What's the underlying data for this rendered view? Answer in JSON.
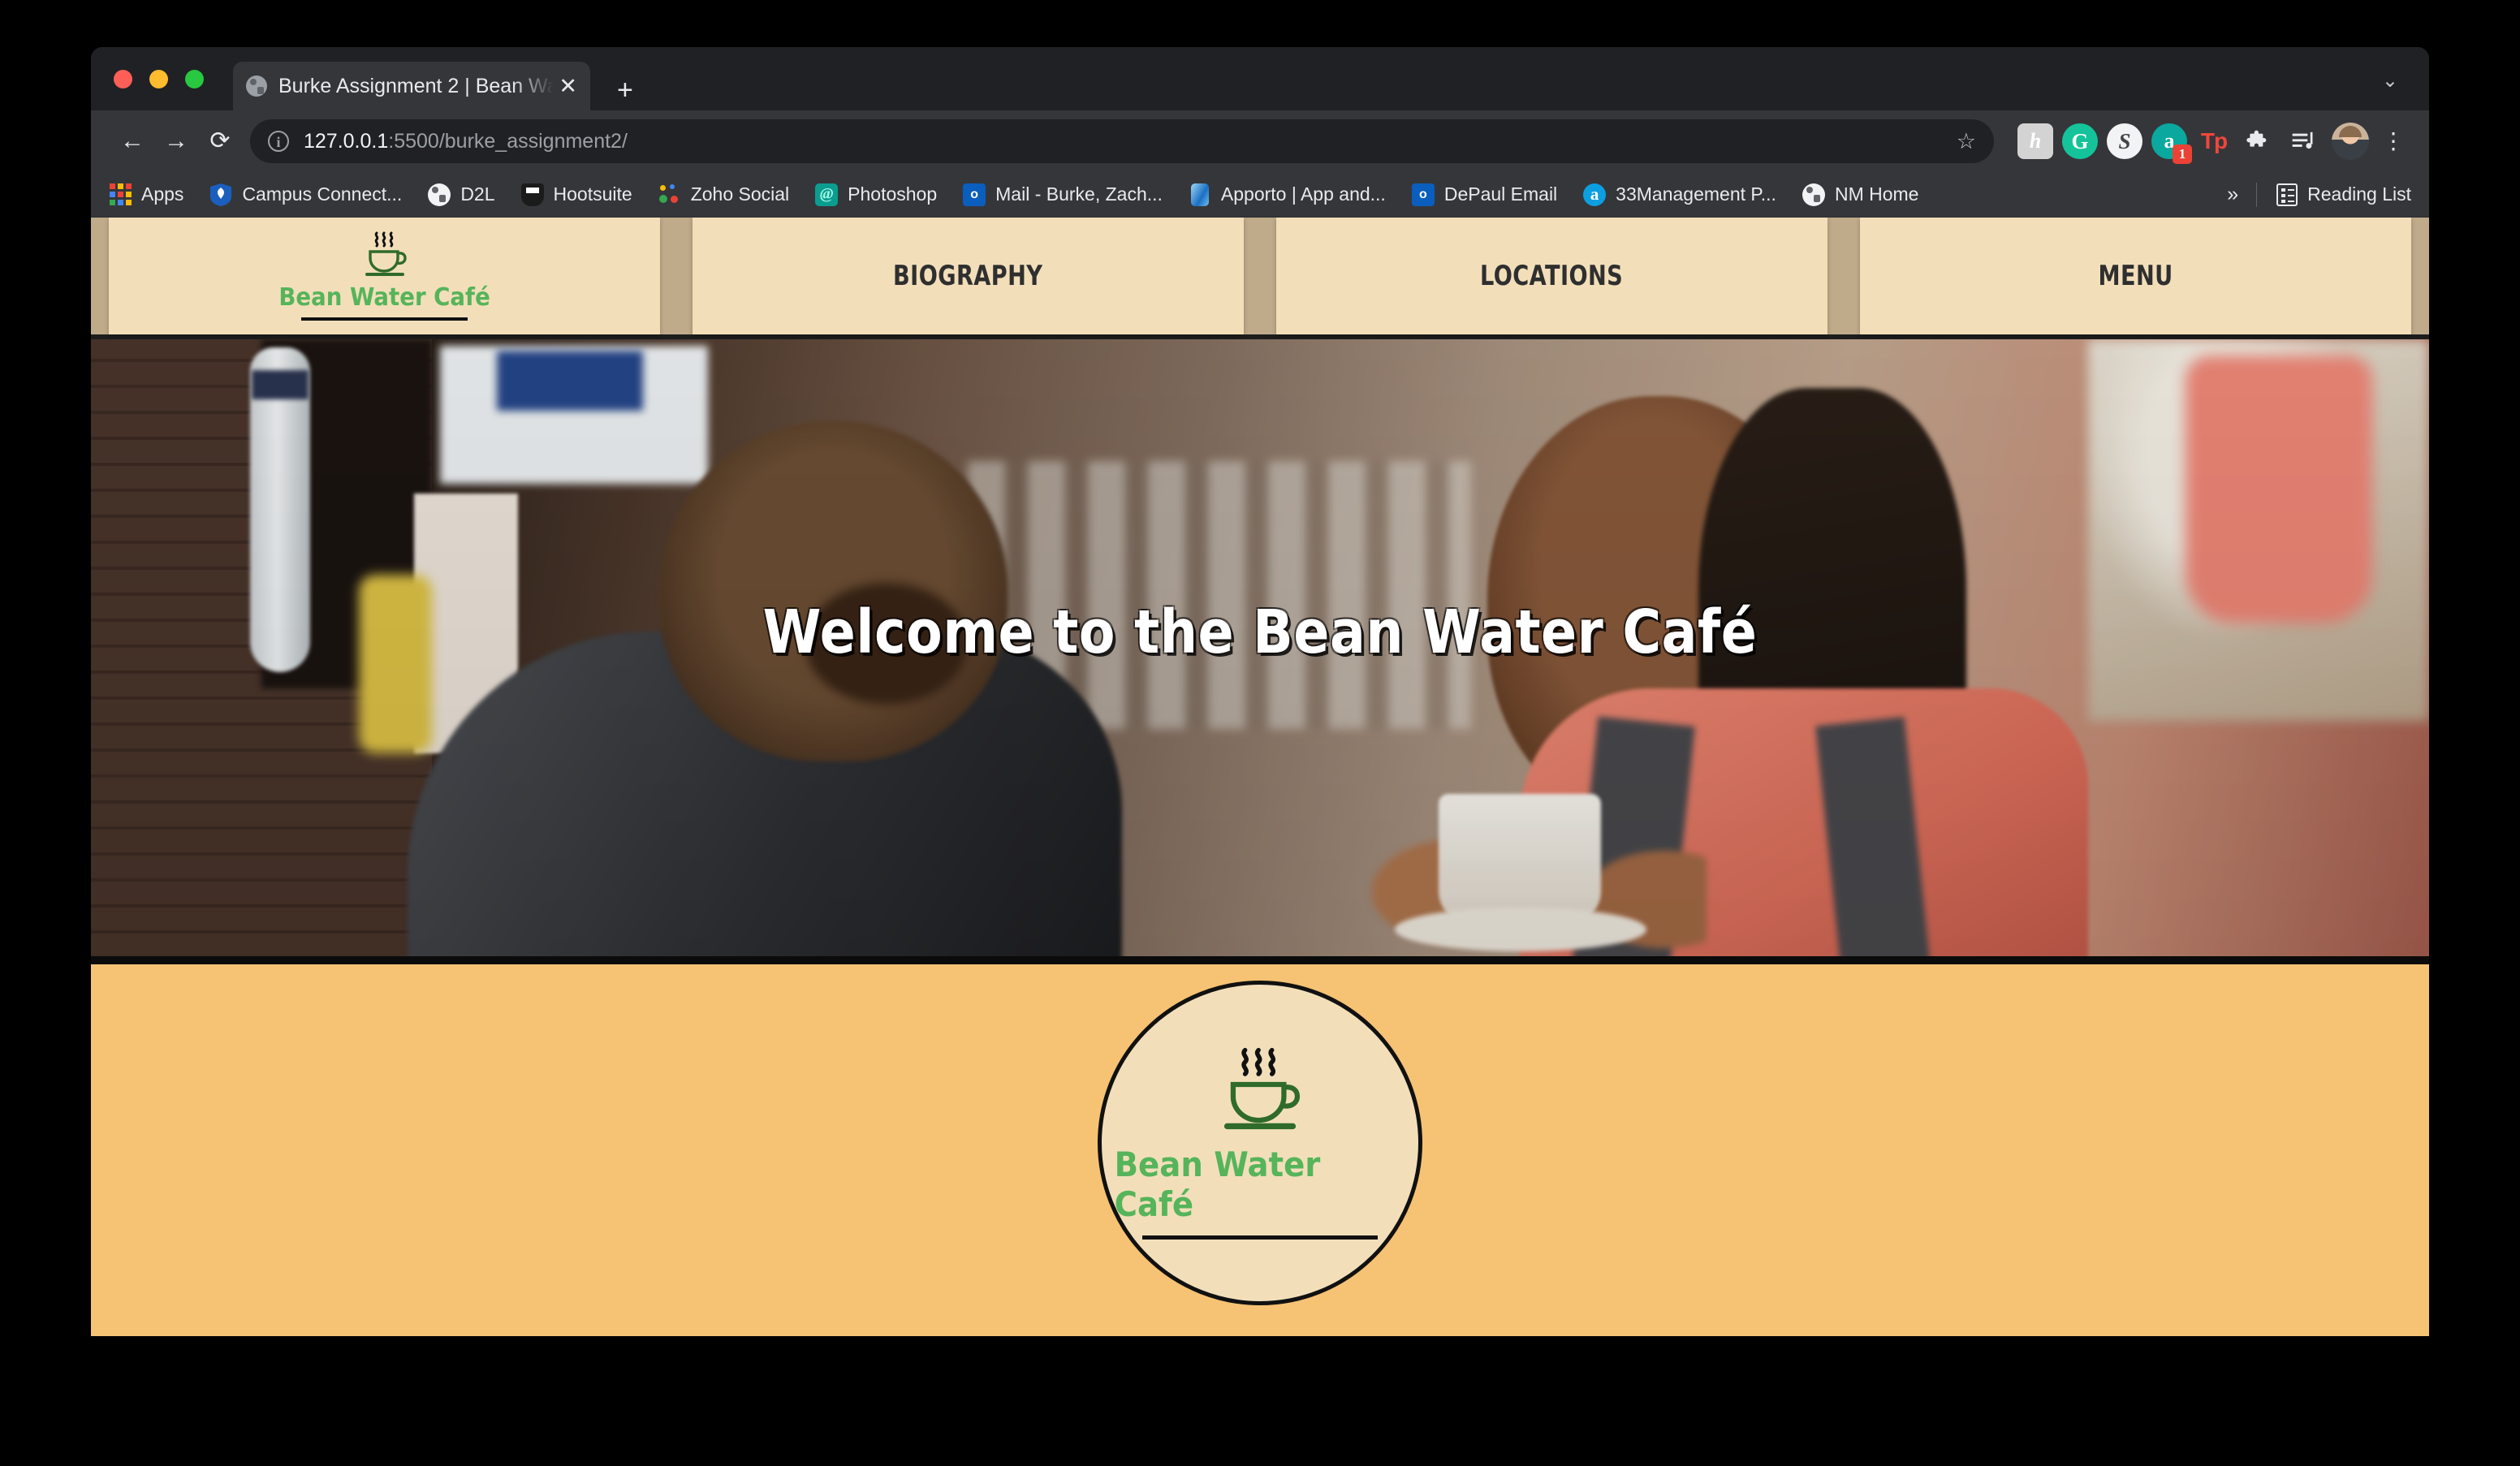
{
  "browser": {
    "tab": {
      "title": "Burke Assignment 2 | Bean Wa",
      "close_label": "✕"
    },
    "new_tab_label": "+",
    "tab_search_label": "⌄",
    "nav": {
      "back": "←",
      "forward": "→",
      "reload": "⟳"
    },
    "omnibox": {
      "info_label": "i",
      "host": "127.0.0.1",
      "path": ":5500/burke_assignment2/",
      "star_label": "☆"
    },
    "extensions": [
      {
        "name": "hypothesis-extension",
        "glyph": "h",
        "badge": ""
      },
      {
        "name": "grammarly-extension",
        "glyph": "G",
        "badge": ""
      },
      {
        "name": "scribe-extension",
        "glyph": "S",
        "badge": ""
      },
      {
        "name": "adobe-extension",
        "glyph": "a",
        "badge": "1"
      },
      {
        "name": "teleprompter-extension",
        "glyph": "Tp",
        "badge": ""
      },
      {
        "name": "extensions-puzzle",
        "glyph": "✦",
        "badge": ""
      },
      {
        "name": "playlist-extension",
        "glyph": "≡♪",
        "badge": ""
      }
    ],
    "menu_label": "⋮",
    "bookmarks": [
      {
        "label": "Apps",
        "icon": "apps-grid-icon"
      },
      {
        "label": "Campus Connect...",
        "icon": "depaul-shield-icon"
      },
      {
        "label": "D2L",
        "icon": "globe-icon"
      },
      {
        "label": "Hootsuite",
        "icon": "owl-icon"
      },
      {
        "label": "Zoho Social",
        "icon": "zoho-dots-icon"
      },
      {
        "label": "Photoshop",
        "icon": "photoshop-icon"
      },
      {
        "label": "Mail - Burke, Zach...",
        "icon": "outlook-icon"
      },
      {
        "label": "Apporto | App and...",
        "icon": "apporto-icon"
      },
      {
        "label": "DePaul Email",
        "icon": "outlook-icon"
      },
      {
        "label": "33Management P...",
        "icon": "asana-icon"
      },
      {
        "label": "NM Home",
        "icon": "globe-icon"
      }
    ],
    "bookmarks_overflow_label": "»",
    "reading_list_label": "Reading List"
  },
  "site": {
    "brand": {
      "name": "Bean Water Café"
    },
    "nav_items": [
      {
        "label": "Bean Water Café",
        "type": "logo"
      },
      {
        "label": "BIOGRAPHY",
        "type": "link"
      },
      {
        "label": "LOCATIONS",
        "type": "link"
      },
      {
        "label": "MENU",
        "type": "link"
      }
    ],
    "hero": {
      "headline": "Welcome to the Bean Water Café"
    },
    "badge": {
      "name": "Bean Water Café"
    }
  },
  "colors": {
    "nav_cell": "#f2dfba",
    "nav_gap": "#bfab8a",
    "band": "#f6c273",
    "brand_green": "#56b45a",
    "cup_green": "#2f6b2a",
    "ink": "#111111"
  }
}
